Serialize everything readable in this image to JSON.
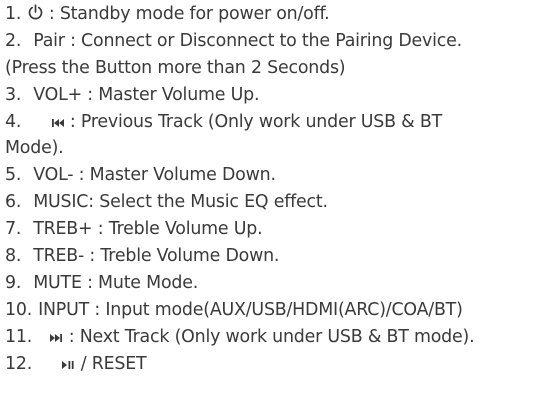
{
  "items": [
    {
      "num": "1.",
      "text": ": Standby mode for power on/off.",
      "icon": "power-icon"
    },
    {
      "num": "2.",
      "text": "Pair : Connect or Disconnect to the Pairing Device."
    },
    {
      "text": "(Press the Button more than 2 Seconds)"
    },
    {
      "num": "3.",
      "text": "VOL+ : Master Volume Up."
    },
    {
      "num": "4.",
      "text": ": Previous Track (Only work under USB & BT",
      "icon": "previous-track-icon"
    },
    {
      "text": "Mode)."
    },
    {
      "num": "5.",
      "text": "VOL- : Master Volume Down."
    },
    {
      "num": "6.",
      "text": "MUSIC: Select the Music EQ effect."
    },
    {
      "num": "7.",
      "text": "TREB+ : Treble Volume Up."
    },
    {
      "num": "8.",
      "text": "TREB- : Treble Volume Down."
    },
    {
      "num": "9.",
      "text": "MUTE : Mute Mode."
    },
    {
      "num": "10.",
      "text": "INPUT : Input mode(AUX/USB/HDMI(ARC)/COA/BT)"
    },
    {
      "num": "11.",
      "text": ": Next Track (Only work under USB & BT mode).",
      "icon": "next-track-icon"
    },
    {
      "num": "12.",
      "text": "/ RESET",
      "icon": "play-pause-icon"
    }
  ]
}
